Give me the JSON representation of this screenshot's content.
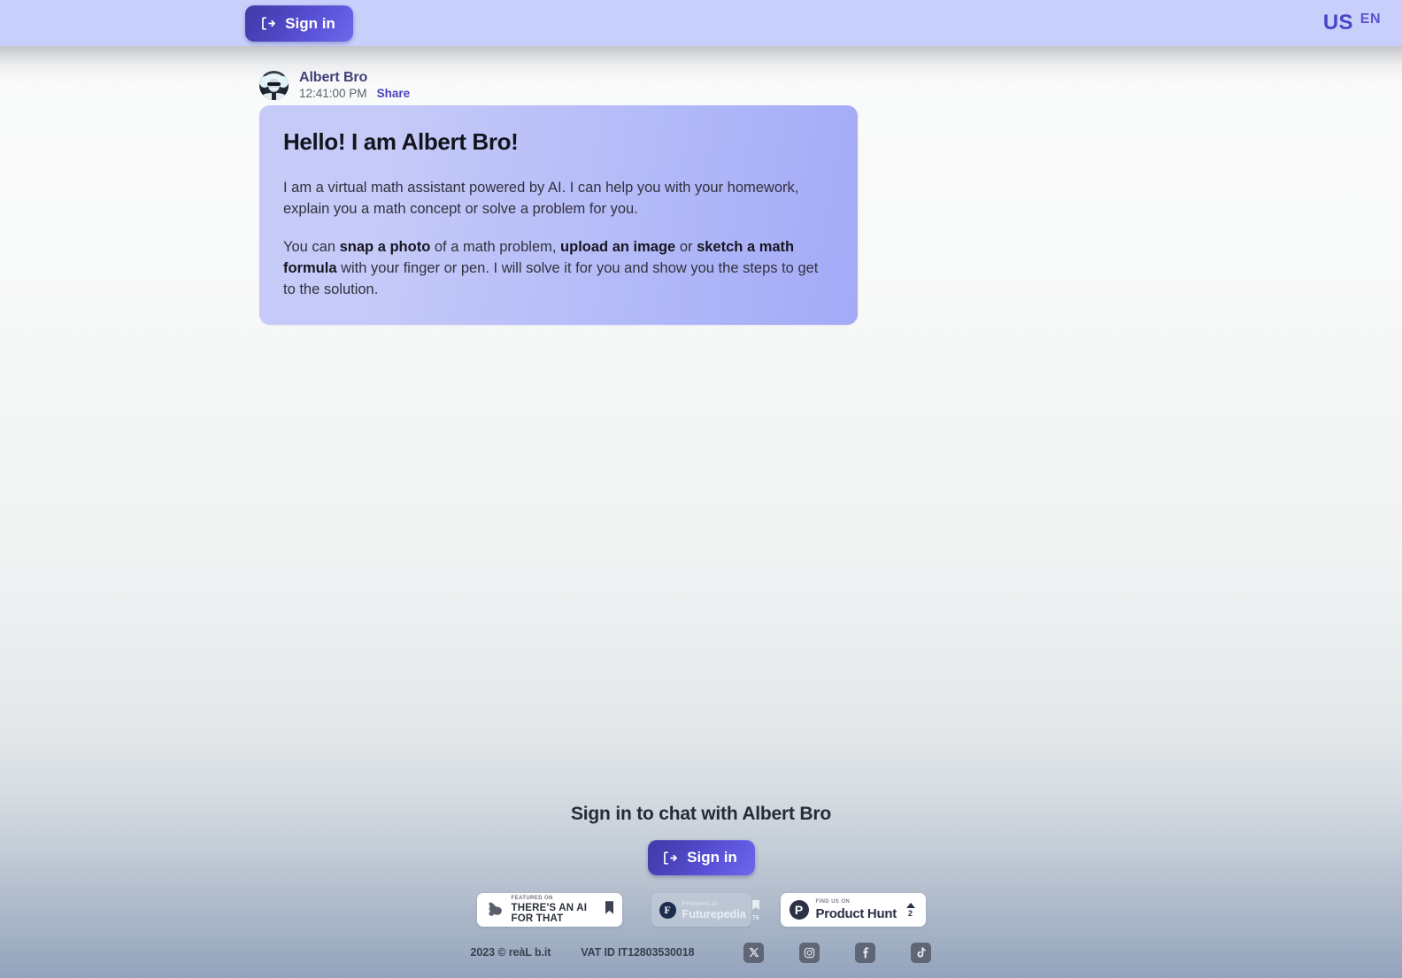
{
  "header": {
    "signin_label": "Sign in",
    "signin_icon": "logout-arrow-icon",
    "country": "US",
    "language": "EN"
  },
  "message": {
    "author": "Albert Bro",
    "time": "12:41:00 PM",
    "share_label": "Share",
    "avatar_icon": "albert-bro-avatar",
    "title": "Hello! I am Albert Bro!",
    "paragraph1": "I am a virtual math assistant powered by AI. I can help you with your homework, explain you a math concept or solve a problem for you.",
    "paragraph2": {
      "seg1": "You can ",
      "bold1": "snap a photo",
      "seg2": " of a math problem, ",
      "bold2": "upload an image",
      "seg3": " or ",
      "bold3": "sketch a math formula",
      "seg4": " with your finger or pen. I will solve it for you and show you the steps to get to the solution."
    }
  },
  "bottom": {
    "title": "Sign in to chat with Albert Bro",
    "signin_label": "Sign in",
    "signin_icon": "logout-arrow-icon"
  },
  "badges": [
    {
      "kicker": "FEATURED ON",
      "name": "THERE'S AN AI FOR THAT",
      "logo_icon": "flexed-bicep-icon",
      "mark_icon": "bookmark-icon",
      "count": ""
    },
    {
      "kicker": "Featured on",
      "name": "Futurepedia",
      "logo_icon": "futurepedia-f-icon",
      "mark_icon": "bookmark-icon",
      "count": "76"
    },
    {
      "kicker": "FIND US ON",
      "name": "Product Hunt",
      "logo_icon": "product-hunt-p-icon",
      "mark_icon": "upvote-triangle-icon",
      "count": "2"
    }
  ],
  "footer": {
    "copyright": "2023 © reàL b.it",
    "vat": "VAT ID IT12803530018",
    "socials": [
      {
        "name": "x-twitter-icon"
      },
      {
        "name": "instagram-icon"
      },
      {
        "name": "facebook-icon"
      },
      {
        "name": "tiktok-icon"
      }
    ]
  },
  "colors": {
    "header_bg": "#c8cffb",
    "accent": "#4a43c4",
    "bubble_from": "#c6caf7",
    "bubble_to": "#a3aaf7"
  }
}
